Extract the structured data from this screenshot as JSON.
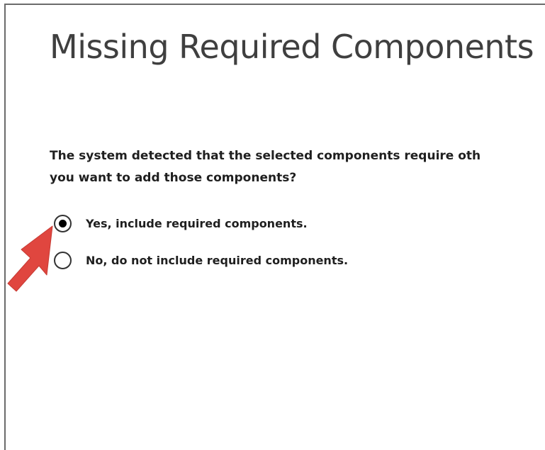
{
  "dialog": {
    "title": "Missing Required Components",
    "question_line1": "The system detected that the selected components require oth",
    "question_line2": "you want to add those components?"
  },
  "options": [
    {
      "label": "Yes, include required components.",
      "checked": true
    },
    {
      "label": "No, do not include required components.",
      "checked": false
    }
  ],
  "colors": {
    "arrow": "#e0463f",
    "title_text": "#3f3f3f",
    "body_text": "#1f1f1f"
  },
  "icons": {
    "arrow": "red-pointer-arrow-icon",
    "radio_selected": "radio-selected-icon",
    "radio_unselected": "radio-unselected-icon"
  }
}
